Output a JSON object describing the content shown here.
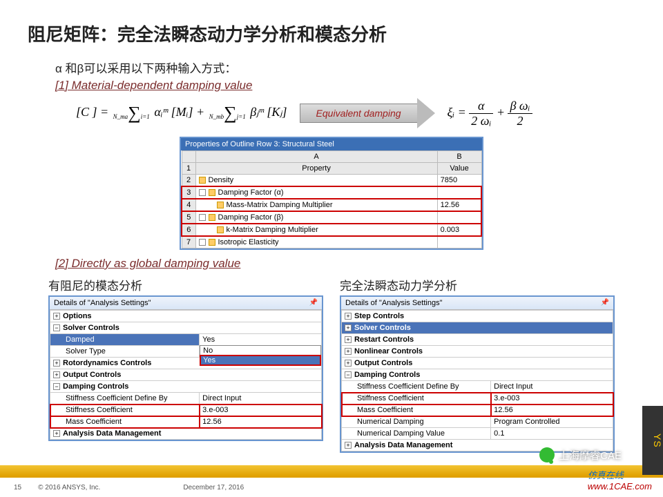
{
  "title": "阻尼矩阵：完全法瞬态动力学分析和模态分析",
  "intro": "α 和β可以采用以下两种输入方式：",
  "section1": "[1] Material-dependent damping value",
  "equivDamping": "Equivalent damping",
  "eq1_c": "[C ] =",
  "eq1_s1top": "N_ma",
  "eq1_s1bot": "i=1",
  "eq1_term1": "αᵢᵐ [Mᵢ] +",
  "eq1_s2top": "N_mb",
  "eq1_s2bot": "j=1",
  "eq1_term2": "βⱼᵐ [Kⱼ]",
  "eq2_xi": "ξᵢ =",
  "eq2_f1n": "α",
  "eq2_f1d": "2 ωᵢ",
  "eq2_plus": "+",
  "eq2_f2n": "β ωᵢ",
  "eq2_f2d": "2",
  "props": {
    "title": "Properties of Outline Row 3: Structural Steel",
    "colA": "A",
    "colB": "B",
    "hProp": "Property",
    "hVal": "Value",
    "rows": [
      {
        "n": "2",
        "a": "Density",
        "b": "7850"
      },
      {
        "n": "3",
        "a": "Damping Factor (α)",
        "b": ""
      },
      {
        "n": "4",
        "a": "Mass-Matrix Damping Multiplier",
        "b": "12.56"
      },
      {
        "n": "5",
        "a": "Damping Factor (β)",
        "b": ""
      },
      {
        "n": "6",
        "a": "k-Matrix Damping Multiplier",
        "b": "0.003"
      },
      {
        "n": "7",
        "a": "Isotropic Elasticity",
        "b": ""
      }
    ]
  },
  "section2": "[2] Directly as global damping value",
  "leftTitle": "有阻尼的模态分析",
  "rightTitle": "完全法瞬态动力学分析",
  "left": {
    "head": "Details of \"Analysis Settings\"",
    "rows": {
      "options": "Options",
      "solver": "Solver Controls",
      "damped": "Damped",
      "dampedVal": "Yes",
      "stype": "Solver Type",
      "no": "No",
      "yes": "Yes",
      "roto": "Rotordynamics Controls",
      "output": "Output Controls",
      "dctrl": "Damping Controls",
      "scdb": "Stiffness Coefficient Define By",
      "direct": "Direct Input",
      "stiff": "Stiffness Coefficient",
      "stiffV": "3.e-003",
      "mass": "Mass Coefficient",
      "massV": "12.56",
      "adm": "Analysis Data Management"
    }
  },
  "right": {
    "head": "Details of \"Analysis Settings\"",
    "rows": {
      "step": "Step Controls",
      "solver": "Solver Controls",
      "restart": "Restart Controls",
      "nonlin": "Nonlinear Controls",
      "output": "Output Controls",
      "dctrl": "Damping Controls",
      "scdb": "Stiffness Coefficient Define By",
      "direct": "Direct Input",
      "stiff": "Stiffness Coefficient",
      "stiffV": "3.e-003",
      "mass": "Mass Coefficient",
      "massV": "12.56",
      "ndamp": "Numerical Damping",
      "prog": "Program Controlled",
      "ndv": "Numerical Damping Value",
      "ndvV": "0.1",
      "adm": "Analysis Data Management"
    }
  },
  "footer": {
    "page": "15",
    "copy": "© 2016 ANSYS, Inc.",
    "date": "December 17, 2016"
  },
  "wm1": "上海摩睿CAE",
  "wm2a": "仿真在线",
  "wm2b": "www.1CAE.com",
  "ansys": "YS"
}
